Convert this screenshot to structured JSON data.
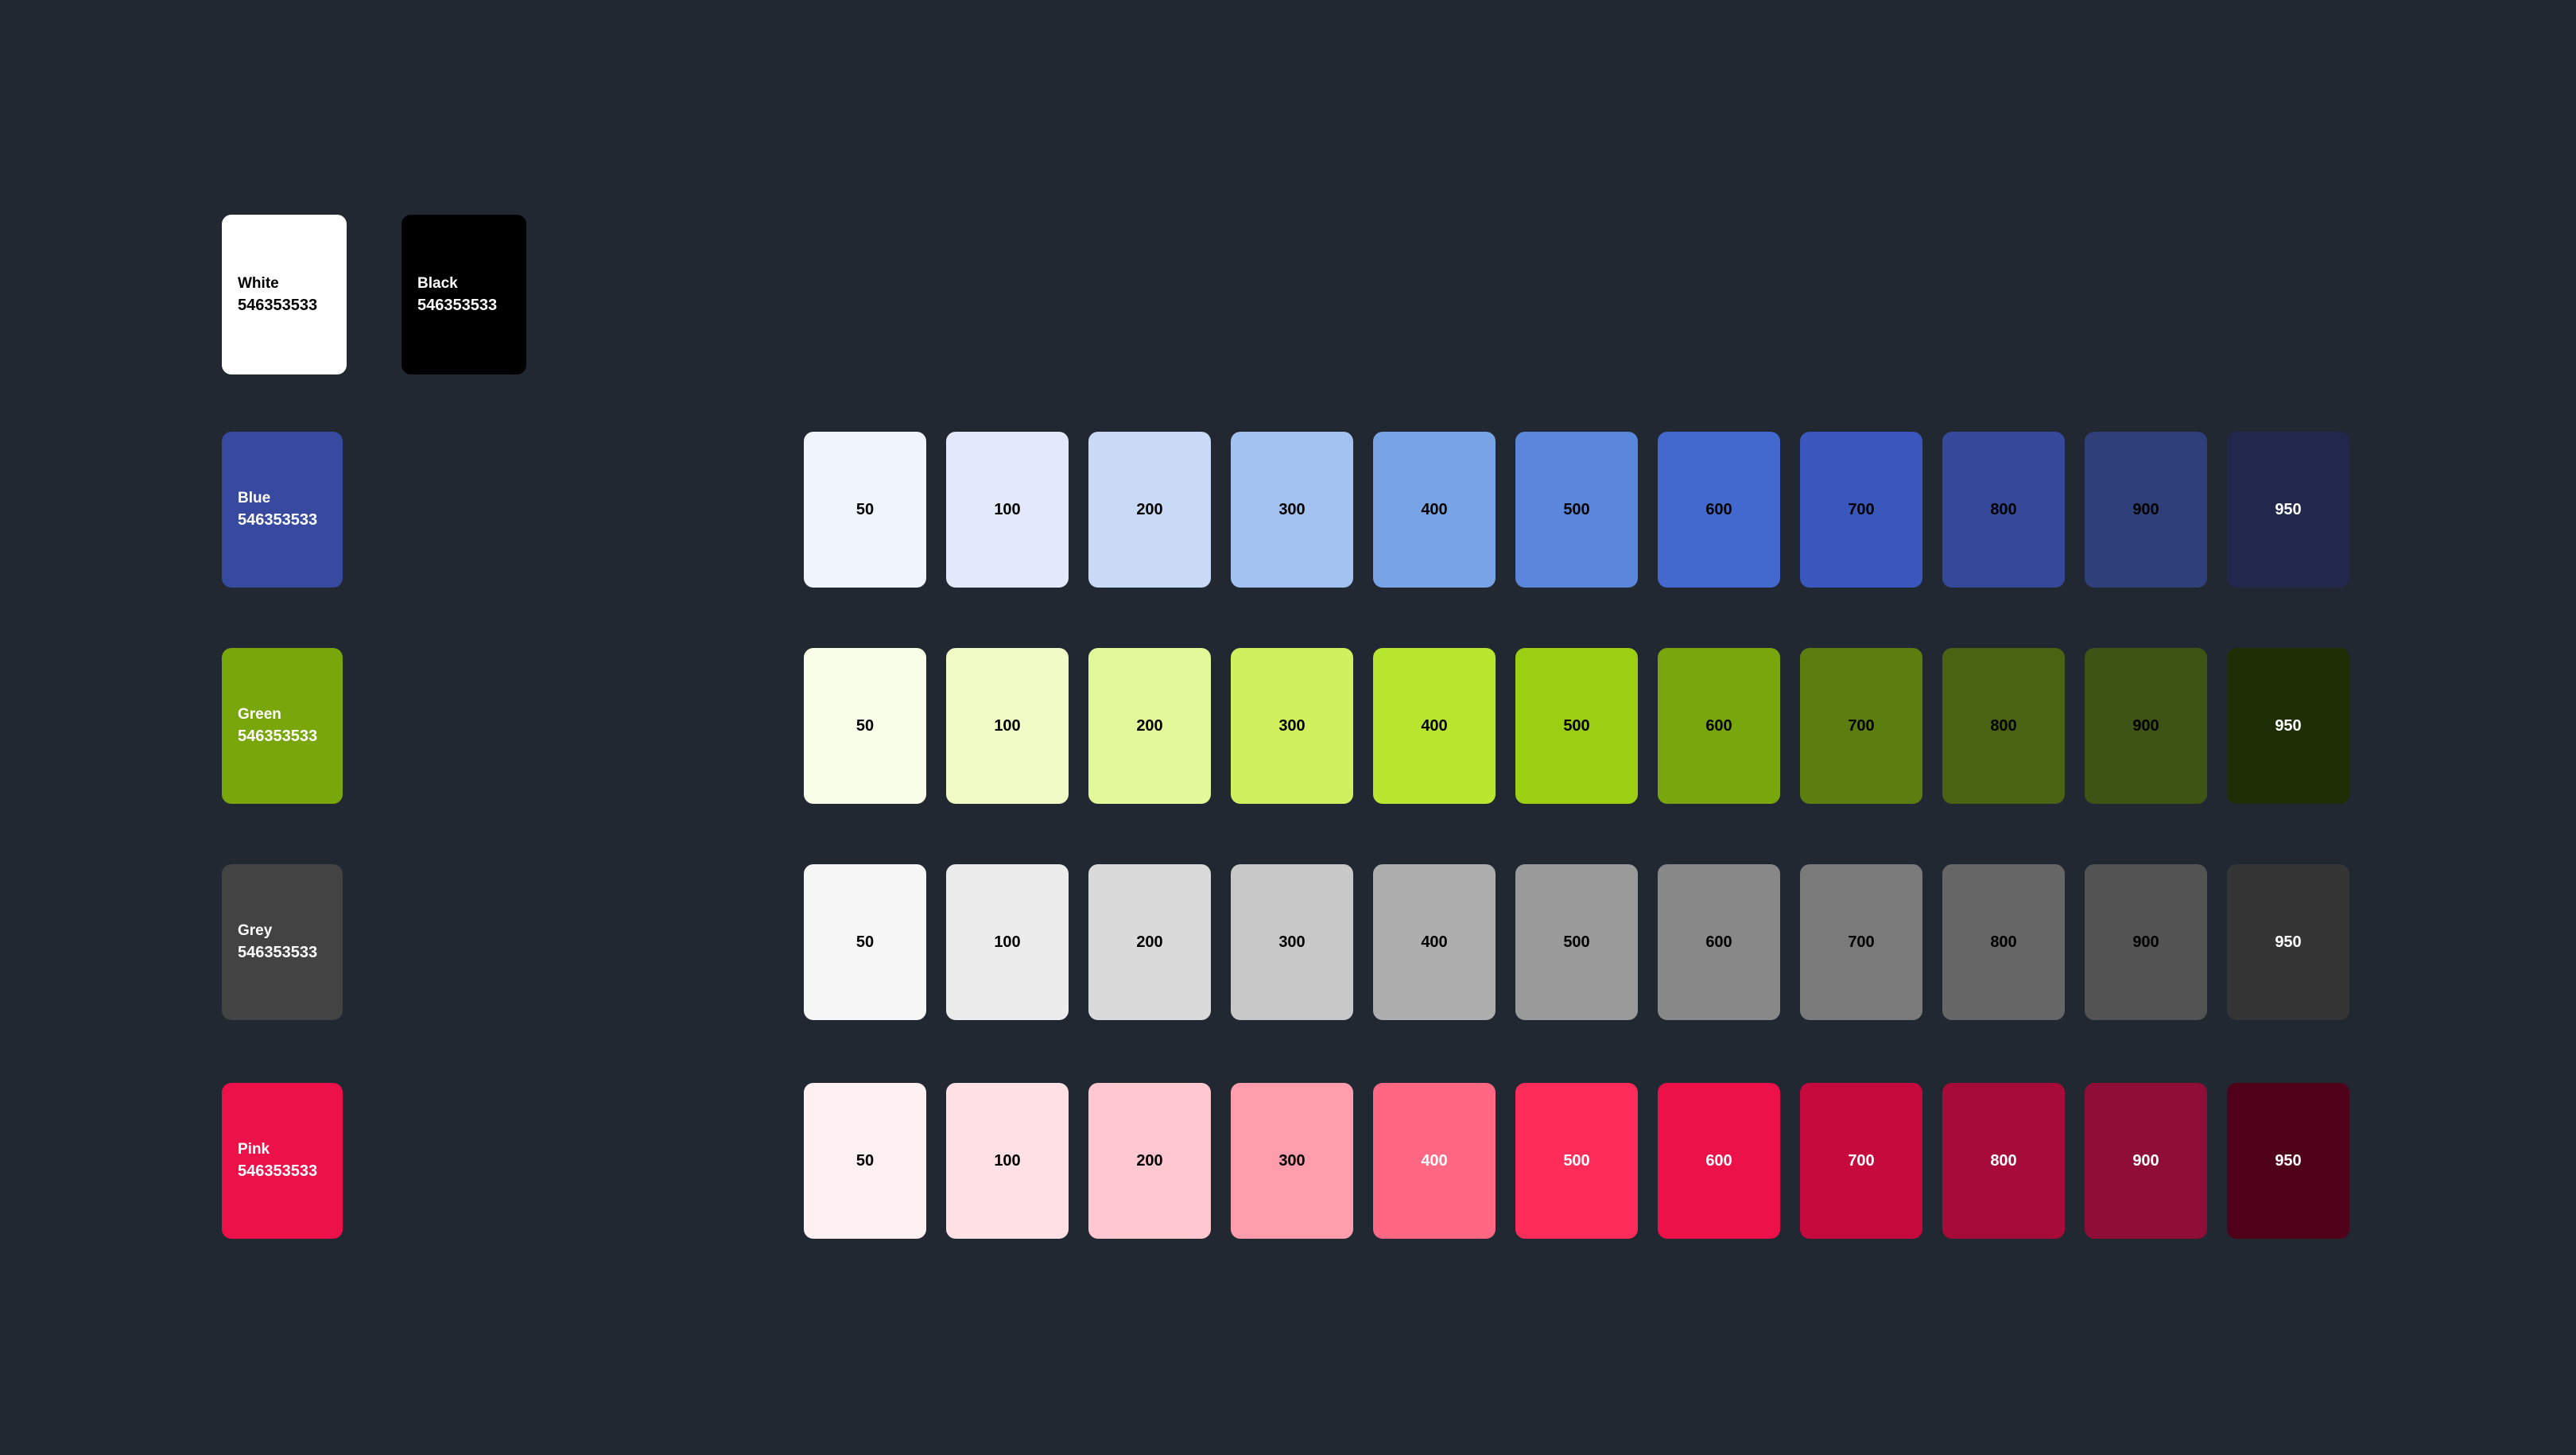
{
  "basics": [
    {
      "name": "White",
      "code": "546353533",
      "color": "#FFFFFF",
      "text_color": "#000000"
    },
    {
      "name": "Black",
      "code": "546353533",
      "color": "#000000",
      "text_color": "#FFFFFF"
    }
  ],
  "palettes": [
    {
      "name": "Blue",
      "code": "546353533",
      "color": "#374AA0",
      "text_color": "#FFFFFF",
      "shades": [
        {
          "label": "50",
          "color": "#F0F4FD",
          "text_color": "#000000"
        },
        {
          "label": "100",
          "color": "#E1E9FA",
          "text_color": "#000000"
        },
        {
          "label": "200",
          "color": "#C9DAF6",
          "text_color": "#000000"
        },
        {
          "label": "300",
          "color": "#A3C2EF",
          "text_color": "#000000"
        },
        {
          "label": "400",
          "color": "#78A3E4",
          "text_color": "#000000"
        },
        {
          "label": "500",
          "color": "#5A86DC",
          "text_color": "#000000"
        },
        {
          "label": "600",
          "color": "#4369CF",
          "text_color": "#000000"
        },
        {
          "label": "700",
          "color": "#3A57BD",
          "text_color": "#000000"
        },
        {
          "label": "800",
          "color": "#354899",
          "text_color": "#000000"
        },
        {
          "label": "900",
          "color": "#2F3F7A",
          "text_color": "#000000"
        },
        {
          "label": "950",
          "color": "#21284B",
          "text_color": "#FFFFFF"
        }
      ]
    },
    {
      "name": "Green",
      "code": "546353533",
      "color": "#78A60B",
      "text_color": "#FFFFFF",
      "shades": [
        {
          "label": "50",
          "color": "#F9FEE8",
          "text_color": "#000000"
        },
        {
          "label": "100",
          "color": "#F1FBC6",
          "text_color": "#000000"
        },
        {
          "label": "200",
          "color": "#E3F899",
          "text_color": "#000000"
        },
        {
          "label": "300",
          "color": "#D0F15F",
          "text_color": "#000000"
        },
        {
          "label": "400",
          "color": "#B9E72F",
          "text_color": "#000000"
        },
        {
          "label": "500",
          "color": "#9CCE14",
          "text_color": "#000000"
        },
        {
          "label": "600",
          "color": "#79A60C",
          "text_color": "#000000"
        },
        {
          "label": "700",
          "color": "#5B7E0F",
          "text_color": "#000000"
        },
        {
          "label": "800",
          "color": "#496312",
          "text_color": "#000000"
        },
        {
          "label": "900",
          "color": "#3D5414",
          "text_color": "#000000"
        },
        {
          "label": "950",
          "color": "#1E2F05",
          "text_color": "#FFFFFF"
        }
      ]
    },
    {
      "name": "Grey",
      "code": "546353533",
      "color": "#434343",
      "text_color": "#FFFFFF",
      "shades": [
        {
          "label": "50",
          "color": "#F6F6F6",
          "text_color": "#000000"
        },
        {
          "label": "100",
          "color": "#ECECEC",
          "text_color": "#000000"
        },
        {
          "label": "200",
          "color": "#DADADA",
          "text_color": "#000000"
        },
        {
          "label": "300",
          "color": "#C8C8C8",
          "text_color": "#000000"
        },
        {
          "label": "400",
          "color": "#AEAEAE",
          "text_color": "#000000"
        },
        {
          "label": "500",
          "color": "#9A9A9A",
          "text_color": "#000000"
        },
        {
          "label": "600",
          "color": "#888888",
          "text_color": "#000000"
        },
        {
          "label": "700",
          "color": "#7A7A7A",
          "text_color": "#000000"
        },
        {
          "label": "800",
          "color": "#666666",
          "text_color": "#000000"
        },
        {
          "label": "900",
          "color": "#535353",
          "text_color": "#000000"
        },
        {
          "label": "950",
          "color": "#353535",
          "text_color": "#FFFFFF"
        }
      ]
    },
    {
      "name": "Pink",
      "code": "546353533",
      "color": "#EC1148",
      "text_color": "#FFFFFF",
      "shades": [
        {
          "label": "50",
          "color": "#FFF0F1",
          "text_color": "#000000"
        },
        {
          "label": "100",
          "color": "#FFE1E5",
          "text_color": "#000000"
        },
        {
          "label": "200",
          "color": "#FFC8D0",
          "text_color": "#000000"
        },
        {
          "label": "300",
          "color": "#FF9DAC",
          "text_color": "#000000"
        },
        {
          "label": "400",
          "color": "#FF6782",
          "text_color": "#FFFFFF"
        },
        {
          "label": "500",
          "color": "#FE2C58",
          "text_color": "#FFFFFF"
        },
        {
          "label": "600",
          "color": "#EC1148",
          "text_color": "#FFFFFF"
        },
        {
          "label": "700",
          "color": "#C60A3D",
          "text_color": "#FFFFFF"
        },
        {
          "label": "800",
          "color": "#A60B39",
          "text_color": "#FFFFFF"
        },
        {
          "label": "900",
          "color": "#8E0E37",
          "text_color": "#FFFFFF"
        },
        {
          "label": "950",
          "color": "#50011A",
          "text_color": "#FFFFFF"
        }
      ]
    }
  ]
}
